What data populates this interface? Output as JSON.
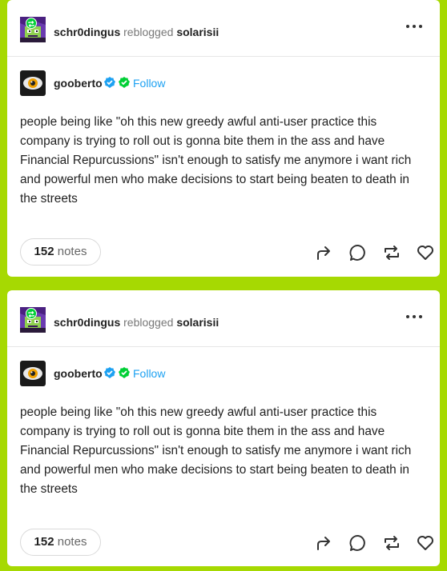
{
  "posts": [
    {
      "reblogger": "schr0dingus",
      "reblogged_text": "reblogged",
      "reblogged_from": "solarisii",
      "author": "gooberto",
      "follow_label": "Follow",
      "body": "people being like \"oh this new greedy awful anti-user practice this company is trying to roll out is gonna bite them in the ass and have Financial Repurcussions\" isn't enough to satisfy me anymore i want rich and powerful men who make decisions to start being beaten to death in the streets",
      "notes_count": "152",
      "notes_label": "notes"
    },
    {
      "reblogger": "schr0dingus",
      "reblogged_text": "reblogged",
      "reblogged_from": "solarisii",
      "author": "gooberto",
      "follow_label": "Follow",
      "body": "people being like \"oh this new greedy awful anti-user practice this company is trying to roll out is gonna bite them in the ass and have Financial Repurcussions\" isn't enough to satisfy me anymore i want rich and powerful men who make decisions to start being beaten to death in the streets",
      "notes_count": "152",
      "notes_label": "notes"
    }
  ],
  "icons": {
    "more": "more-dots-icon",
    "share": "share-icon",
    "reply": "reply-icon",
    "reblog": "reblog-icon",
    "like": "heart-icon"
  },
  "colors": {
    "background": "#a6d902",
    "follow": "#1da1f2",
    "verified_blue": "#1da1f2",
    "verified_green": "#00cf35"
  }
}
